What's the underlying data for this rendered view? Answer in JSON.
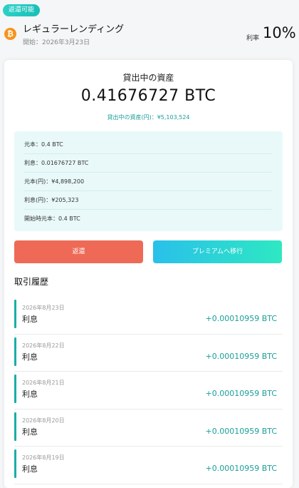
{
  "header": {
    "badge": "返還可能",
    "coin_icon": "bitcoin-icon",
    "coin_symbol": "₿",
    "product_name": "レギュラーレンディング",
    "start_date": "開始：2026年3月23日",
    "rate_label": "利率",
    "rate_value": "10%"
  },
  "summary": {
    "title": "貸出中の資産",
    "amount": "0.41676727 BTC",
    "jpy_value": "貸出中の資産(円)：¥5,103,524"
  },
  "details": [
    "元本：0.4 BTC",
    "利息：0.01676727 BTC",
    "元本(円)：¥4,898,200",
    "利息(円)：¥205,323",
    "開始時元本：0.4 BTC"
  ],
  "actions": {
    "repay_label": "返還",
    "premium_label": "プレミアムへ移行"
  },
  "history": {
    "title": "取引履歴",
    "items": [
      {
        "date": "2026年8月23日",
        "type": "利息",
        "amount": "+0.00010959 BTC"
      },
      {
        "date": "2026年8月22日",
        "type": "利息",
        "amount": "+0.00010959 BTC"
      },
      {
        "date": "2026年8月21日",
        "type": "利息",
        "amount": "+0.00010959 BTC"
      },
      {
        "date": "2026年8月20日",
        "type": "利息",
        "amount": "+0.00010959 BTC"
      },
      {
        "date": "2026年8月19日",
        "type": "利息",
        "amount": "+0.00010959 BTC"
      }
    ]
  },
  "colors": {
    "accent": "#1a9e98",
    "repay_button": "#ee6a56",
    "bitcoin": "#f7931a"
  }
}
